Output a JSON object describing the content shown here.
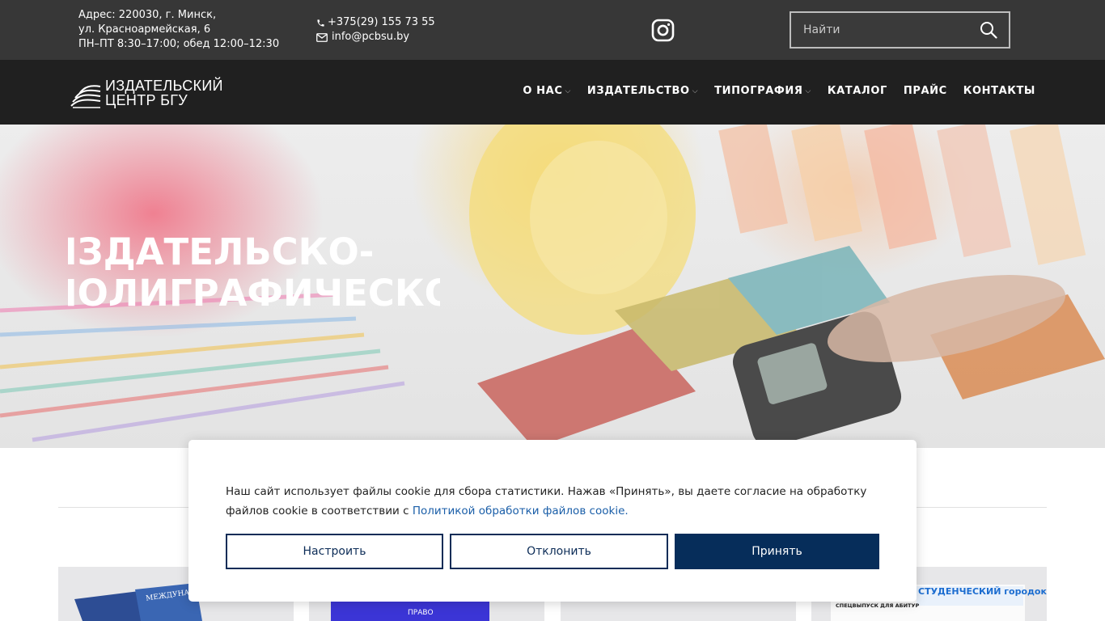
{
  "topbar": {
    "address_lines": [
      "Адрес: 220030, г. Минск,",
      "ул. Красноармейская, 6",
      "ПН–ПТ  8:30–17:00;  обед 12:00–12:30"
    ],
    "phone": "+375(29) 155 73 55",
    "email": "info@pcbsu.by",
    "social_icon": "instagram-icon",
    "search": {
      "placeholder": "Найти",
      "icon": "search-icon"
    }
  },
  "header": {
    "logo_lines": [
      "ИЗДАТЕЛЬСКИЙ",
      "ЦЕНТР БГУ"
    ],
    "nav": [
      {
        "label": "О НАС",
        "has_dropdown": true
      },
      {
        "label": "ИЗДАТЕЛЬСТВО",
        "has_dropdown": true
      },
      {
        "label": "ТИПОГРАФИЯ",
        "has_dropdown": true
      },
      {
        "label": "КАТАЛОГ",
        "has_dropdown": false
      },
      {
        "label": "ПРАЙС",
        "has_dropdown": false
      },
      {
        "label": "КОНТАКТЫ",
        "has_dropdown": false
      }
    ]
  },
  "hero": {
    "title_lines": [
      "ИЗДАТЕЛЬСКО-",
      "ПОЛИГРАФИЧЕСКОЕ"
    ]
  },
  "cookie_banner": {
    "text": "Наш сайт использует файлы cookie для сбора статистики. Нажав «Принять», вы даете согласие на обработку файлов cookie в соответствии с ",
    "link_text": "Политикой обработки файлов cookie.",
    "buttons": {
      "configure": "Настроить",
      "decline": "Отклонить",
      "accept": "Принять"
    }
  },
  "cards": {
    "card_1_text": "МЕЖДУНАРО",
    "card_2_text": "ПРАВО",
    "card_4_text": "СТУДЕНЧЕСКИЙ городок",
    "card_4_sub": "СПЕЦВЫПУСК ДЛЯ АБИТУР"
  },
  "colors": {
    "topbar_bg": "#373737",
    "navbar_bg": "#202020",
    "accent_navy": "#062d5a",
    "link_blue": "#1a5ea8"
  }
}
